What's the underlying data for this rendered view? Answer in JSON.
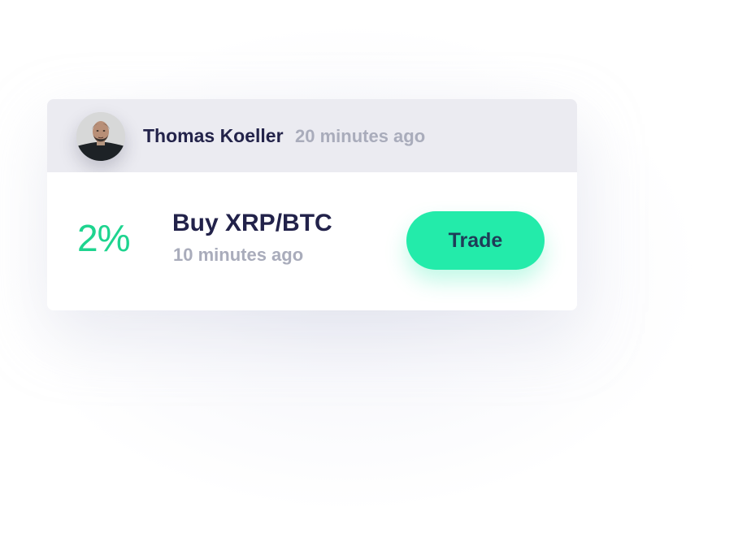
{
  "activity": {
    "user_name": "Thomas Koeller",
    "posted_time": "20 minutes ago",
    "percent": "2%",
    "trade_pair": "Buy XRP/BTC",
    "trade_time": "10 minutes ago",
    "trade_button_label": "Trade"
  },
  "colors": {
    "header_background": "#ebebf1",
    "percent_green": "#1ed48f",
    "button_green": "#23ebaa",
    "title_text": "#22224a",
    "muted_text": "#a9acbb"
  },
  "icons": {
    "avatar": "user-photo"
  }
}
